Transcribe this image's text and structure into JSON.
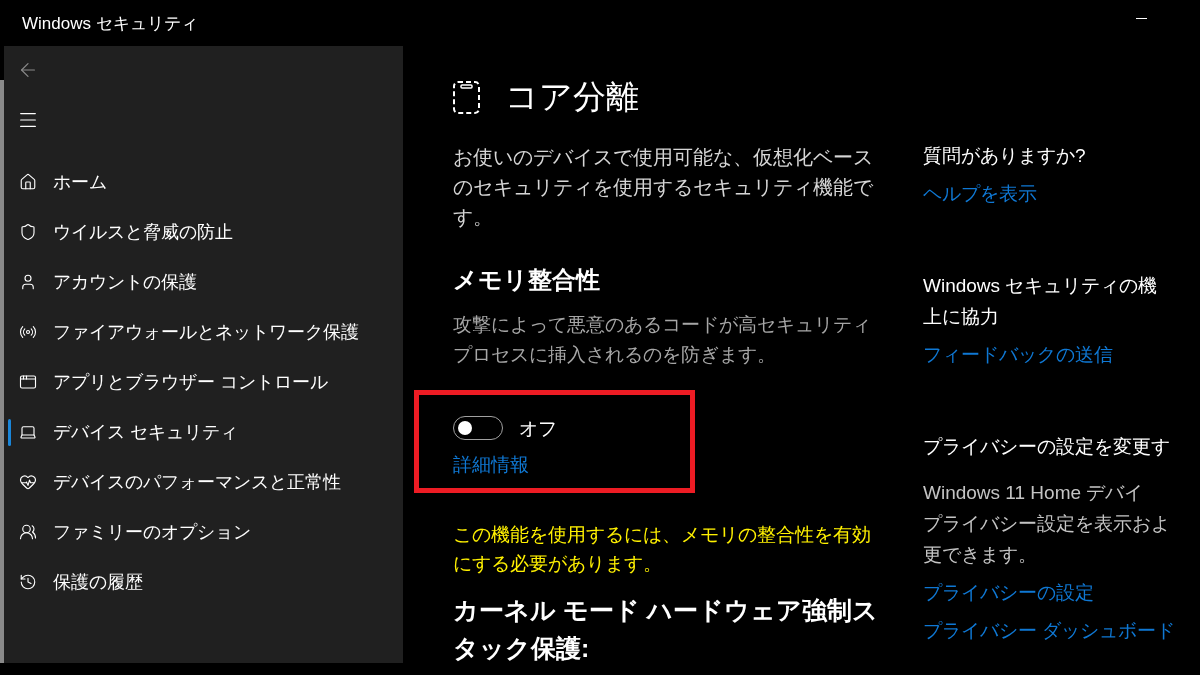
{
  "window": {
    "title": "Windows セキュリティ"
  },
  "navigation": {
    "back_button": {
      "disabled": true
    },
    "items": [
      {
        "label": "ホーム",
        "selected": false
      },
      {
        "label": "ウイルスと脅威の防止",
        "selected": false
      },
      {
        "label": "アカウントの保護",
        "selected": false
      },
      {
        "label": "ファイアウォールとネットワーク保護",
        "selected": false
      },
      {
        "label": "アプリとブラウザー コントロール",
        "selected": false
      },
      {
        "label": "デバイス セキュリティ",
        "selected": true
      },
      {
        "label": "デバイスのパフォーマンスと正常性",
        "selected": false
      },
      {
        "label": "ファミリーのオプション",
        "selected": false
      },
      {
        "label": "保護の履歴",
        "selected": false
      }
    ]
  },
  "page": {
    "title": "コア分離",
    "description": "お使いのデバイスで使用可能な、仮想化ベースのセキュリティを使用するセキュリティ機能です。"
  },
  "memory_integrity": {
    "title": "メモリ整合性",
    "description": "攻撃によって悪意のあるコードが高セキュリティプロセスに挿入されるのを防ぎます。",
    "highlighted": true,
    "toggle": {
      "on": false,
      "label": "オフ"
    },
    "link": "詳細情報",
    "warning": "この機能を使用するには、メモリの整合性を有効にする必要があります。"
  },
  "kernel_stack_protection": {
    "title": "カーネル モード ハードウェア強制スタック保護:"
  },
  "side_panel": {
    "sections": [
      {
        "heading_lines": [
          "質問がありますか?"
        ],
        "links": [
          "ヘルプを表示"
        ]
      },
      {
        "heading_lines": [
          "Windows セキュリティの機",
          "上に協力"
        ],
        "links": [
          "フィードバックの送信"
        ]
      },
      {
        "heading_lines": [
          "プライバシーの設定を変更す"
        ],
        "body_lines": [
          "Windows 11 Home デバイ",
          "プライバシー設定を表示およ",
          "更できます。"
        ],
        "links": [
          "プライバシーの設定",
          "プライバシー ダッシュボード"
        ]
      }
    ]
  }
}
